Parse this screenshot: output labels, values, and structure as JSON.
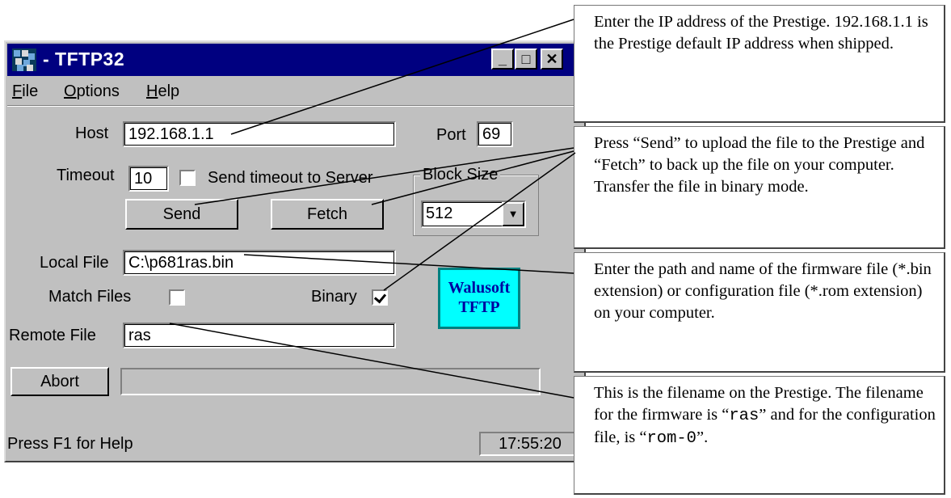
{
  "window": {
    "title": "- TFTP32",
    "controls": {
      "minimize": "_",
      "maximize": "□",
      "close": "✕"
    }
  },
  "menu": [
    {
      "label": "File",
      "underline": "F",
      "rest": "ile"
    },
    {
      "label": "Options",
      "underline": "O",
      "rest": "ptions"
    },
    {
      "label": "Help",
      "underline": "H",
      "rest": "elp"
    }
  ],
  "form": {
    "host_label": "Host",
    "host_value": "192.168.1.1",
    "port_label": "Port",
    "port_value": "69",
    "timeout_label": "Timeout",
    "timeout_value": "10",
    "send_timeout_label": "Send timeout to Server",
    "send_timeout_checked": false,
    "block_size_label": "Block Size",
    "block_size_value": "512",
    "send_label": "Send",
    "fetch_label": "Fetch",
    "local_file_label": "Local File",
    "local_file_value": "C:\\p681ras.bin",
    "match_files_label": "Match Files",
    "match_files_checked": false,
    "binary_label": "Binary",
    "binary_checked": true,
    "remote_file_label": "Remote File",
    "remote_file_value": "ras",
    "abort_label": "Abort",
    "progress": 0
  },
  "logo": {
    "line1": "Walusoft",
    "line2": "TFTP"
  },
  "status": {
    "help": "Press F1 for Help",
    "time": "17:55:20"
  },
  "callouts": {
    "host": "Enter the IP address of the Prestige. 192.168.1.1 is the Prestige default IP address when shipped.",
    "send_fetch": "Press “Send” to upload the file to the Prestige and “Fetch” to back up the file on your computer. Transfer the file in binary mode.",
    "local_file": "Enter the path and name of the firmware file (*.bin extension) or configuration file (*.rom extension) on your computer.",
    "remote_file": {
      "part1": "This is the filename on the Prestige. The filename for the firmware is “",
      "code1": "ras",
      "part2": "” and for the configuration file, is “",
      "code2": "rom-0",
      "part3": "”."
    }
  }
}
